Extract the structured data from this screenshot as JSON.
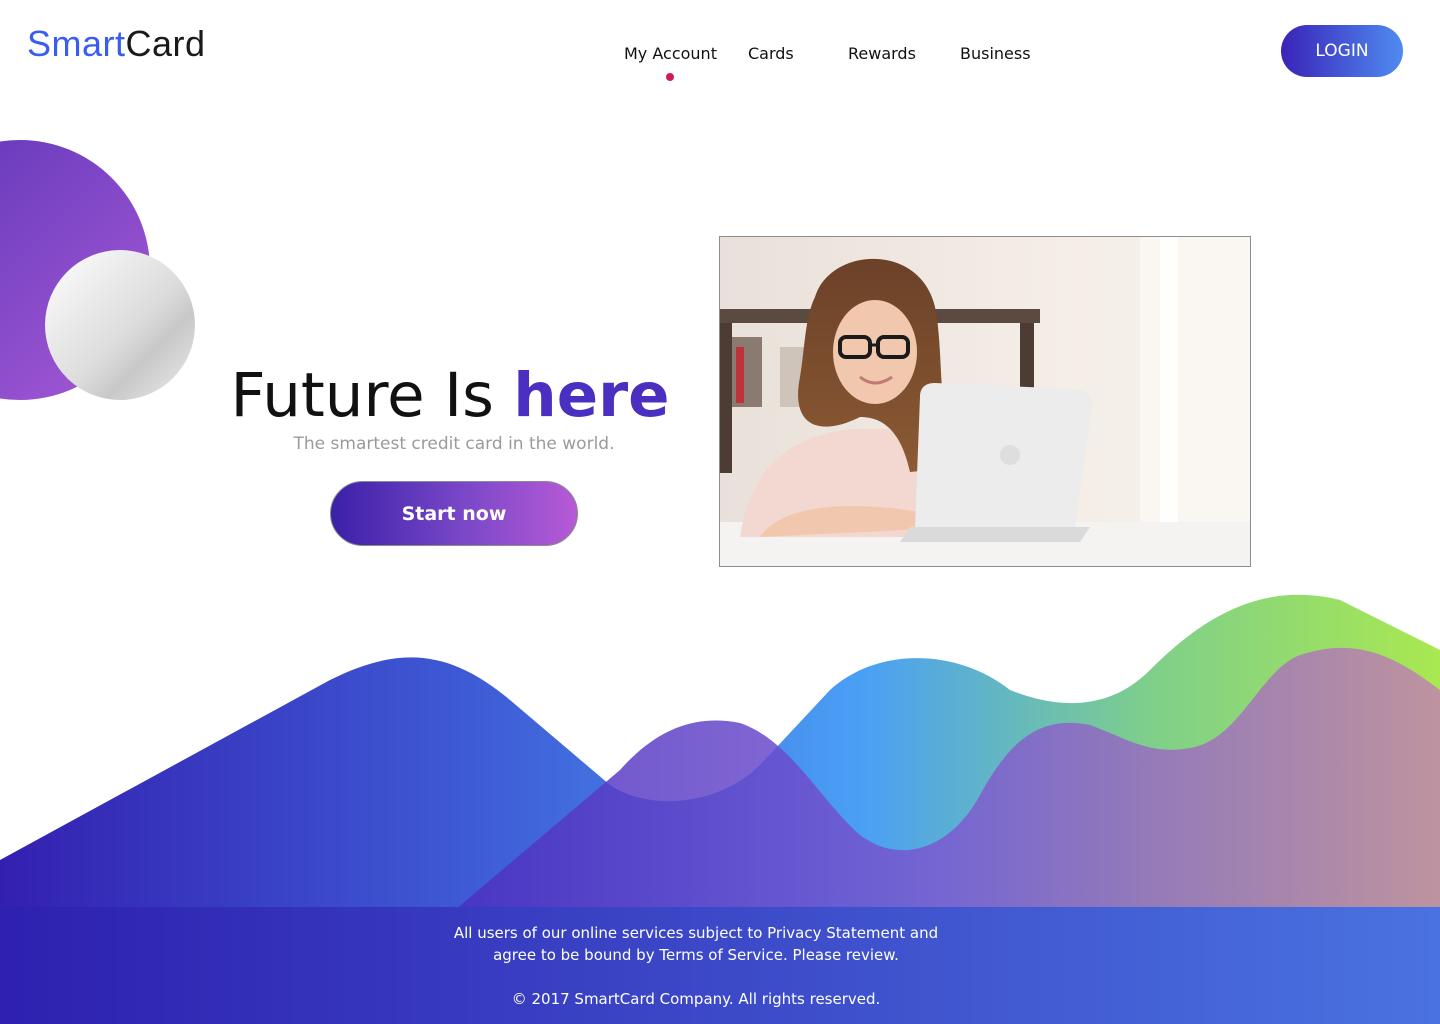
{
  "brand": {
    "part1": "Smart",
    "part2": "Card",
    "color1": "#3a5cf0",
    "color2": "#1a1a1a"
  },
  "nav": {
    "items": [
      {
        "label": "My Account",
        "active": true
      },
      {
        "label": "Cards",
        "active": false
      },
      {
        "label": "Rewards",
        "active": false
      },
      {
        "label": "Business",
        "active": false
      }
    ],
    "active_indicator_color": "#d11a5a"
  },
  "header": {
    "login_label": "LOGIN"
  },
  "hero": {
    "title_prefix": "Future Is ",
    "title_accent": "here",
    "subtitle": "The smartest credit card in the world.",
    "cta_label": "Start now",
    "accent_color": "#4b2fc0",
    "image_subject": "woman-with-glasses-using-laptop"
  },
  "footer": {
    "line1": "All users of our online services subject to Privacy Statement and",
    "line2": "agree to be bound by Terms of Service. Please review.",
    "copyright": "© 2017 SmartCard Company. All rights reserved."
  }
}
